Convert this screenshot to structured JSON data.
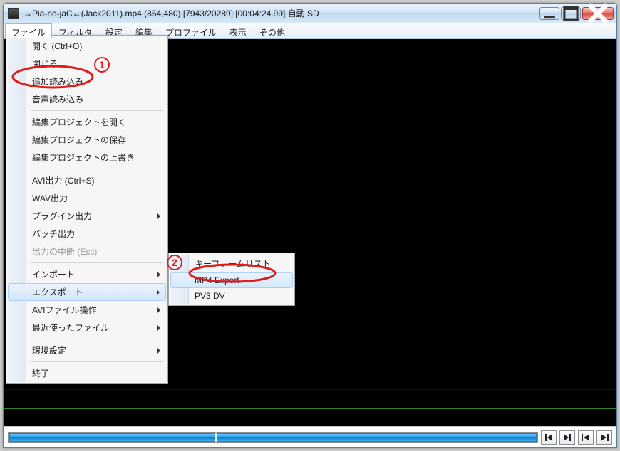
{
  "titlebar": {
    "title": "→Pia-no-jaC←(Jack2011).mp4 (854,480)  [7943/20289] [00:04:24.99]  自動  SD"
  },
  "menubar": {
    "file": "ファイル",
    "filter": "フィルタ",
    "settings": "設定",
    "edit": "編集",
    "profile": "プロファイル",
    "view": "表示",
    "other": "その他"
  },
  "menu": {
    "open": "開く (Ctrl+O)",
    "close": "閉じる",
    "append": "追加読み込み",
    "audio_load": "音声読み込み",
    "proj_open": "編集プロジェクトを開く",
    "proj_save": "編集プロジェクトの保存",
    "proj_overwrite": "編集プロジェクトの上書き",
    "avi_out": "AVI出力 (Ctrl+S)",
    "wav_out": "WAV出力",
    "plugin_out": "プラグイン出力",
    "batch_out": "バッチ出力",
    "abort_out": "出力の中断 (Esc)",
    "import": "インポート",
    "export": "エクスポート",
    "avi_ops": "AVIファイル操作",
    "recent": "最近使ったファイル",
    "pref": "環境設定",
    "exit": "終了"
  },
  "submenu": {
    "keyframe": "キーフレームリスト",
    "mp4export": "MP4 Export",
    "pv3dv": "PV3 DV"
  },
  "annot": {
    "one": "1",
    "two": "2"
  }
}
